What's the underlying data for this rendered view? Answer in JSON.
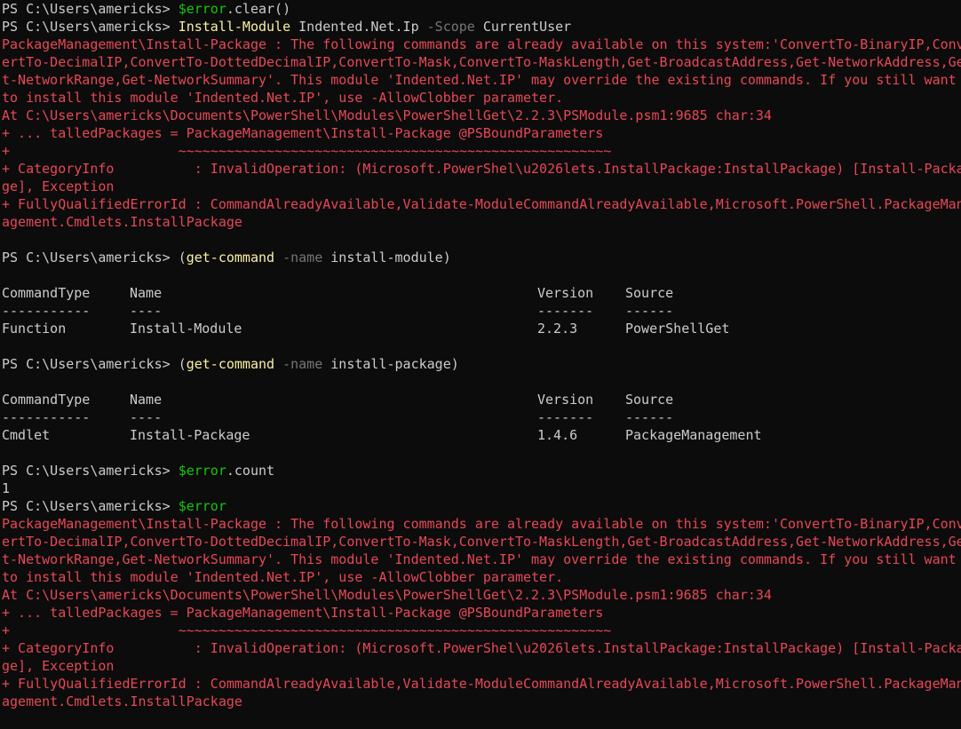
{
  "prompt": "PS C:\\Users\\americks> ",
  "commands": {
    "c1": {
      "var": "$error",
      "rest": ".clear()"
    },
    "c2": {
      "name": "Install-Module",
      "arg1": " Indented.Net.Ip ",
      "param": "-Scope",
      "arg2": " CurrentUser"
    },
    "c3": {
      "open": "(",
      "name": "get-command",
      "param": " -name",
      "arg": " install-module)"
    },
    "c4": {
      "open": "(",
      "name": "get-command",
      "param": " -name",
      "arg": " install-package)"
    },
    "c5": {
      "var": "$error",
      "rest": ".count"
    },
    "c6": {
      "var": "$error"
    }
  },
  "count_output": "1",
  "error_lines": [
    "PackageManagement\\Install-Package : The following commands are already available on this system:'ConvertTo-BinaryIP,Conv",
    "ertTo-DecimalIP,ConvertTo-DottedDecimalIP,ConvertTo-Mask,ConvertTo-MaskLength,Get-BroadcastAddress,Get-NetworkAddress,Ge",
    "t-NetworkRange,Get-NetworkSummary'. This module 'Indented.Net.IP' may override the existing commands. If you still want",
    "to install this module 'Indented.Net.IP', use -AllowClobber parameter.",
    "At C:\\Users\\americks\\Documents\\PowerShell\\Modules\\PowerShellGet\\2.2.3\\PSModule.psm1:9685 char:34",
    "+ ... talledPackages = PackageManagement\\Install-Package @PSBoundParameters",
    "+                     ~~~~~~~~~~~~~~~~~~~~~~~~~~~~~~~~~~~~~~~~~~~~~~~~~~~~~~",
    "+ CategoryInfo          : InvalidOperation: (Microsoft.PowerShel\\u2026lets.InstallPackage:InstallPackage) [Install-Packa",
    "ge], Exception",
    "+ FullyQualifiedErrorId : CommandAlreadyAvailable,Validate-ModuleCommandAlreadyAvailable,Microsoft.PowerShell.PackageMan",
    "agement.Cmdlets.InstallPackage"
  ],
  "table_headers": [
    "CommandType",
    "Name",
    "Version",
    "Source"
  ],
  "table_rules": [
    "-----------",
    "----",
    "-------",
    "------"
  ],
  "table1_row": [
    "Function",
    "Install-Module",
    "2.2.3",
    "PowerShellGet"
  ],
  "table2_row": [
    "Cmdlet",
    "Install-Package",
    "1.4.6",
    "PackageManagement"
  ]
}
